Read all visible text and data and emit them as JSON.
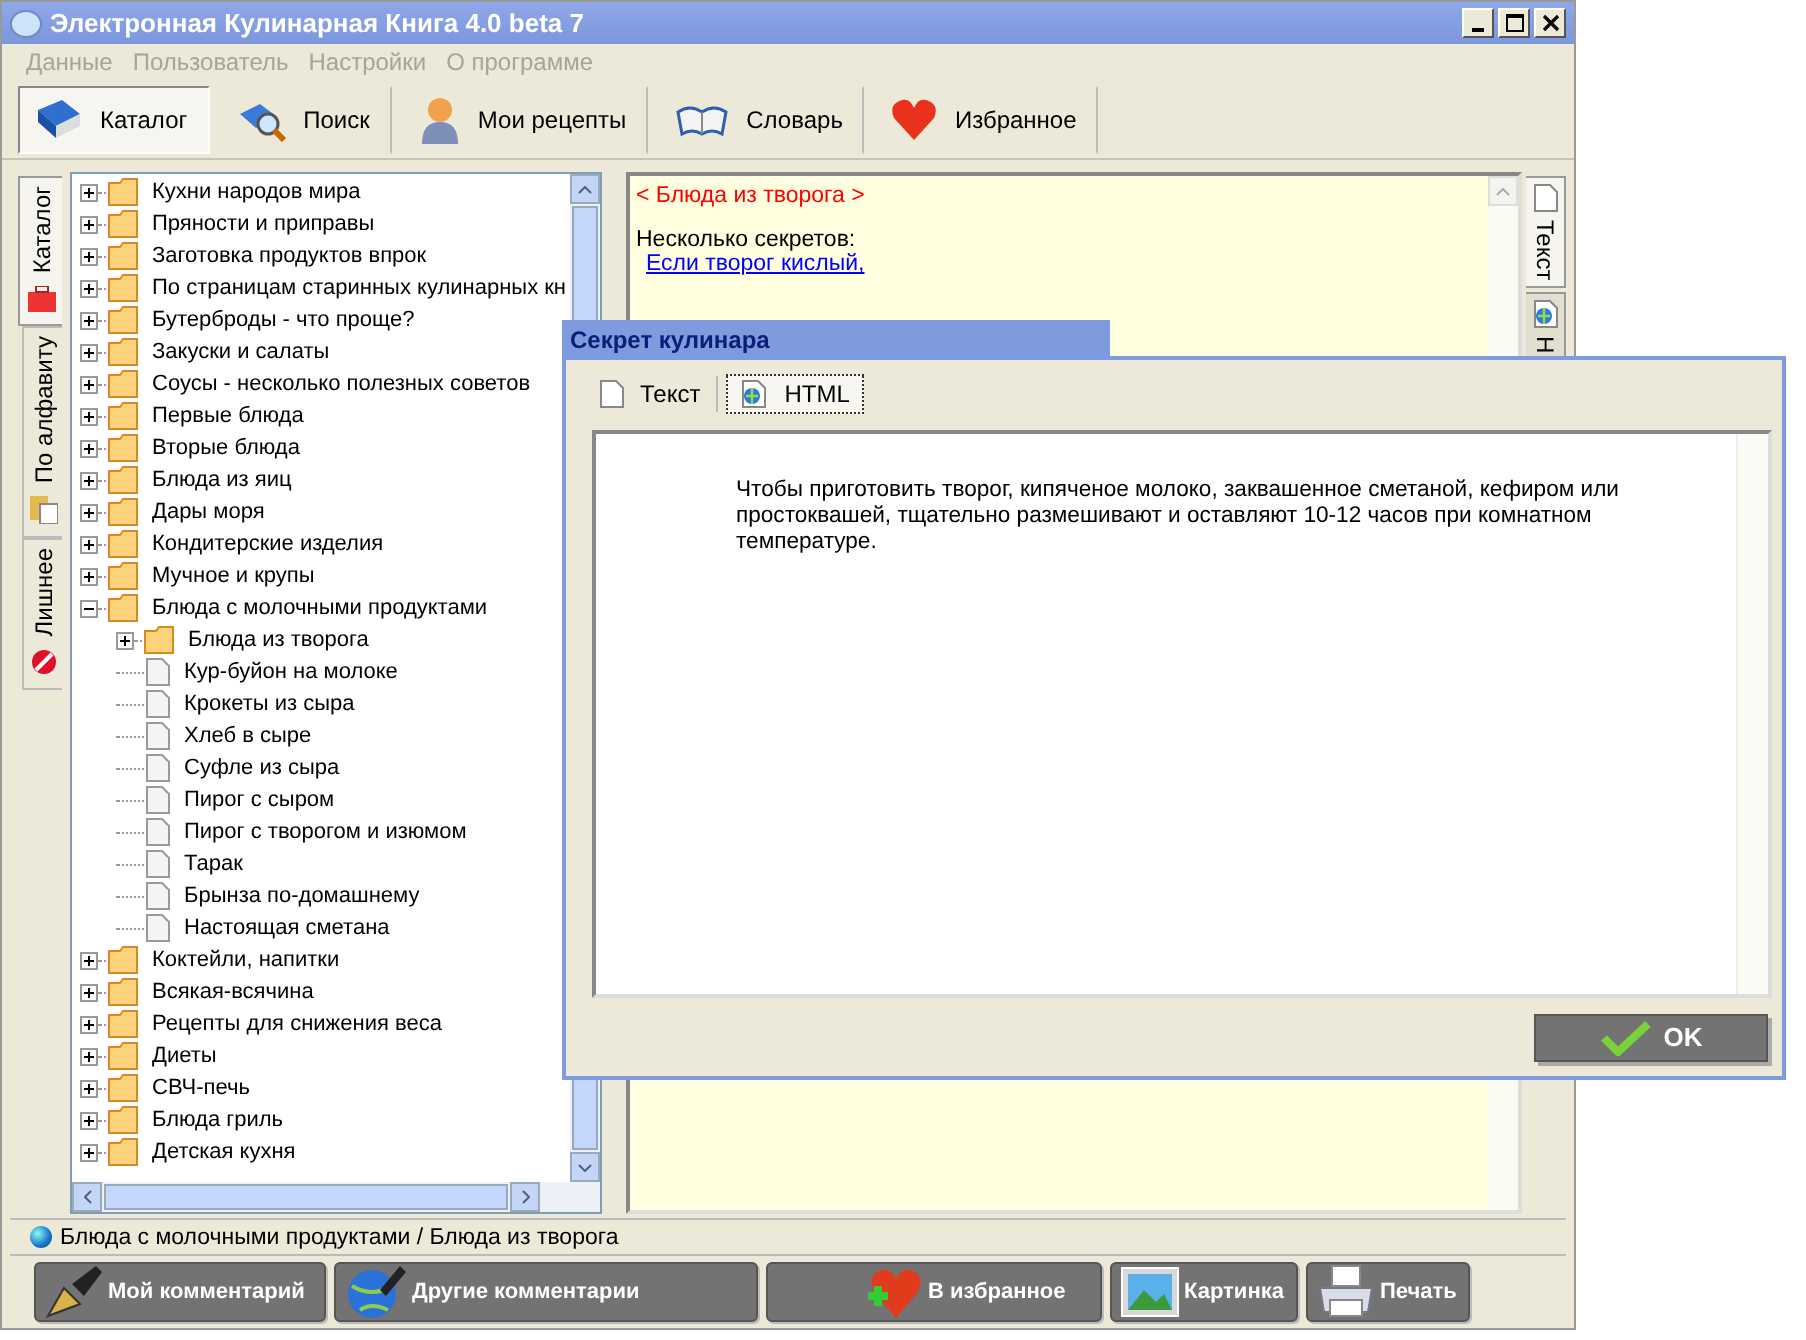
{
  "window": {
    "title": "Электронная Кулинарная Книга 4.0 beta 7"
  },
  "menu": [
    {
      "label": "Данные",
      "disabled": true
    },
    {
      "label": "Пользователь",
      "disabled": true
    },
    {
      "label": "Настройки",
      "disabled": true
    },
    {
      "label": "О программе",
      "disabled": true
    }
  ],
  "toolbar": [
    {
      "label": "Каталог",
      "kind": "book",
      "selected": true
    },
    {
      "label": "Поиск",
      "kind": "search",
      "selected": false
    },
    {
      "label": "Мои рецепты",
      "kind": "person",
      "selected": false
    },
    {
      "label": "Словарь",
      "kind": "openbook",
      "selected": false
    },
    {
      "label": "Избранное",
      "kind": "heart",
      "selected": false
    }
  ],
  "side_tabs": [
    {
      "label": "Каталог",
      "kind": "case",
      "selected": true
    },
    {
      "label": "По алфавиту",
      "kind": "clipboard",
      "selected": false
    },
    {
      "label": "Лишнее",
      "kind": "forbidden",
      "selected": false
    }
  ],
  "tree": [
    {
      "label": "Кухни народов мира",
      "kind": "folder",
      "expanded": false
    },
    {
      "label": "Пряности и приправы",
      "kind": "folder",
      "expanded": false
    },
    {
      "label": "Заготовка продуктов впрок",
      "kind": "folder",
      "expanded": false
    },
    {
      "label": "По страницам старинных кулинарных кн",
      "kind": "folder",
      "expanded": false
    },
    {
      "label": "Бутерброды - что проще?",
      "kind": "folder",
      "expanded": false
    },
    {
      "label": "Закуски и салаты",
      "kind": "folder",
      "expanded": false
    },
    {
      "label": "Соусы - несколько полезных советов",
      "kind": "folder",
      "expanded": false
    },
    {
      "label": "Первые блюда",
      "kind": "folder",
      "expanded": false
    },
    {
      "label": "Вторые блюда",
      "kind": "folder",
      "expanded": false
    },
    {
      "label": "Блюда из яиц",
      "kind": "folder",
      "expanded": false
    },
    {
      "label": "Дары моря",
      "kind": "folder",
      "expanded": false
    },
    {
      "label": "Кондитерские изделия",
      "kind": "folder",
      "expanded": false
    },
    {
      "label": "Мучное и крупы",
      "kind": "folder",
      "expanded": false
    },
    {
      "label": "Блюда с молочными продуктами",
      "kind": "folder",
      "expanded": true,
      "children": [
        {
          "label": "Блюда из творога",
          "kind": "folder",
          "expanded": false
        },
        {
          "label": "Кур-буйон на молоке",
          "kind": "document"
        },
        {
          "label": "Крокеты из сыра",
          "kind": "document"
        },
        {
          "label": "Хлеб в сыре",
          "kind": "document"
        },
        {
          "label": "Суфле из сыра",
          "kind": "document"
        },
        {
          "label": "Пирог с сыром",
          "kind": "document"
        },
        {
          "label": "Пирог с творогом и изюмом",
          "kind": "document"
        },
        {
          "label": "Тарак",
          "kind": "document"
        },
        {
          "label": "Брынза по-домашнему",
          "kind": "document"
        },
        {
          "label": "Настоящая сметана",
          "kind": "document"
        }
      ]
    },
    {
      "label": "Коктейли, напитки",
      "kind": "folder",
      "expanded": false
    },
    {
      "label": "Всякая-всячина",
      "kind": "folder",
      "expanded": false
    },
    {
      "label": "Рецепты для снижения веса",
      "kind": "folder",
      "expanded": false
    },
    {
      "label": "Диеты",
      "kind": "folder",
      "expanded": false
    },
    {
      "label": "СВЧ-печь",
      "kind": "folder",
      "expanded": false
    },
    {
      "label": "Блюда гриль",
      "kind": "folder",
      "expanded": false
    },
    {
      "label": "Детская кухня",
      "kind": "folder",
      "expanded": false
    }
  ],
  "article": {
    "heading": "< Блюда из творога >",
    "intro": "Несколько секретов:",
    "link": "Если творог кислый,"
  },
  "view_tabs": [
    {
      "label": "Текст",
      "kind": "text",
      "selected": true
    },
    {
      "label": "Н",
      "kind": "html",
      "selected": false
    }
  ],
  "dialog": {
    "title": "Секрет кулинара",
    "tabs": [
      {
        "label": "Текст",
        "kind": "text",
        "selected": false
      },
      {
        "label": "HTML",
        "kind": "html",
        "selected": true
      }
    ],
    "text": "Чтобы приготовить творог, кипяченое молоко, заквашенное сметаной, кефиром или простоквашей, тщательно размешивают и оставляют 10-12 часов при комнатном температуре.",
    "ok": "OK"
  },
  "status_bar": {
    "path": "Блюда с молочными продуктами / Блюда из творога"
  },
  "buttons": [
    {
      "label": "Мой комментарий",
      "kind": "pen"
    },
    {
      "label": "Другие комментарии",
      "kind": "globepen"
    },
    {
      "label": "В избранное",
      "kind": "heartplus"
    },
    {
      "label": "Картинка",
      "kind": "picture"
    },
    {
      "label": "Печать",
      "kind": "printer"
    }
  ]
}
